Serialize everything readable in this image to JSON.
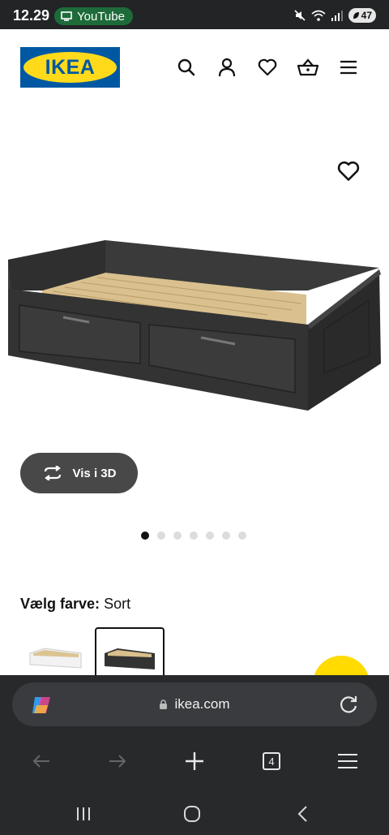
{
  "status_bar": {
    "time": "12.29",
    "app_pill": "YouTube",
    "battery": "47"
  },
  "header": {
    "logo_text": "IKEA",
    "icons": [
      "search-icon",
      "user-icon",
      "heart-icon",
      "basket-icon",
      "menu-icon"
    ]
  },
  "product": {
    "view_3d_label": "Vis i 3D",
    "image_count": 7,
    "active_image": 1
  },
  "color_choice": {
    "label": "Vælg farve:",
    "value": "Sort",
    "options": [
      "white",
      "black"
    ],
    "selected": "black"
  },
  "browser": {
    "url": "ikea.com",
    "tab_count": "4"
  },
  "colors": {
    "ikea_blue": "#0058a3",
    "ikea_yellow": "#ffda1a",
    "browser_bg": "#28292b"
  }
}
